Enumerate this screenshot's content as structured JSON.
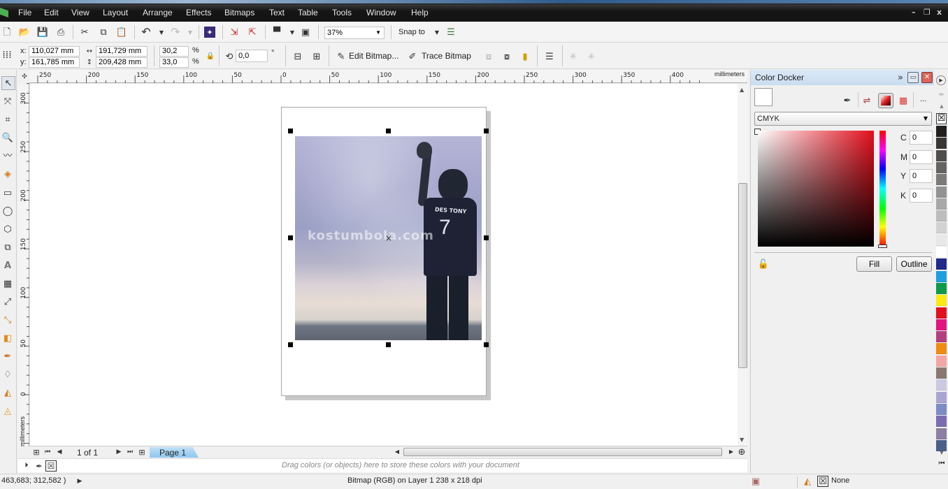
{
  "menu": [
    "File",
    "Edit",
    "View",
    "Layout",
    "Arrange",
    "Effects",
    "Bitmaps",
    "Text",
    "Table",
    "Tools",
    "Window",
    "Help"
  ],
  "window_controls": {
    "minimize": "–",
    "restore": "❐",
    "close": "x"
  },
  "toolbar1": {
    "zoom_level": "37%",
    "snap_to": "Snap to"
  },
  "property_bar": {
    "x_label": "x:",
    "x_value": "110,027 mm",
    "y_label": "y:",
    "y_value": "161,785 mm",
    "width_value": "191,729 mm",
    "height_value": "209,428 mm",
    "scale_x": "30,2",
    "scale_y": "33,0",
    "percent": "%",
    "rotation": "0,0",
    "degree": "°",
    "edit_bitmap": "Edit Bitmap...",
    "trace_bitmap": "Trace Bitmap"
  },
  "ruler_top": {
    "ticks": [
      "250",
      "200",
      "150",
      "100",
      "50",
      "0",
      "50",
      "100",
      "150",
      "200",
      "250",
      "300",
      "350",
      "400"
    ],
    "unit": "millimeters"
  },
  "ruler_left": {
    "ticks": [
      "300",
      "250",
      "200",
      "150",
      "100",
      "50",
      "0"
    ],
    "unit": "millimeters"
  },
  "canvas": {
    "watermark": "kostumbola.com",
    "jersey_name": "DES TONY",
    "jersey_number": "7"
  },
  "page_nav": {
    "page_count": "1 of 1",
    "page_tab": "Page 1"
  },
  "color_bar": {
    "hint": "Drag colors (or objects) here to store these colors with your document"
  },
  "status": {
    "coordinates": "463,683; 312,582 )",
    "object_info": "Bitmap (RGB) on Layer 1 238 x 218 dpi",
    "fill_value": "None"
  },
  "docker": {
    "title": "Color Docker",
    "color_model": "CMYK",
    "channels": [
      {
        "label": "C",
        "value": "0"
      },
      {
        "label": "M",
        "value": "0"
      },
      {
        "label": "Y",
        "value": "0"
      },
      {
        "label": "K",
        "value": "0"
      }
    ],
    "fill_button": "Fill",
    "outline_button": "Outline",
    "more": "..."
  },
  "palette": {
    "swatches": [
      "#231f1c",
      "#3a3634",
      "#4f4d4c",
      "#666463",
      "#7d7b7a",
      "#939292",
      "#a9a8a8",
      "#bdbcbc",
      "#d2d2d2",
      "#e8e8e8",
      "#ffffff",
      "#1f2a8a",
      "#1f9ee0",
      "#0d9a4a",
      "#fbea11",
      "#e3101d",
      "#e4137e",
      "#b2407e",
      "#f08c12",
      "#f2a7a4",
      "#8a7870",
      "#cdc9e2",
      "#a9a5d1",
      "#7c8dc6",
      "#7b6db0",
      "#8d7ea4",
      "#4c5f8c"
    ]
  },
  "colors": {
    "accent": "#3b8bd4",
    "page_tab": "#9fcdf2"
  }
}
